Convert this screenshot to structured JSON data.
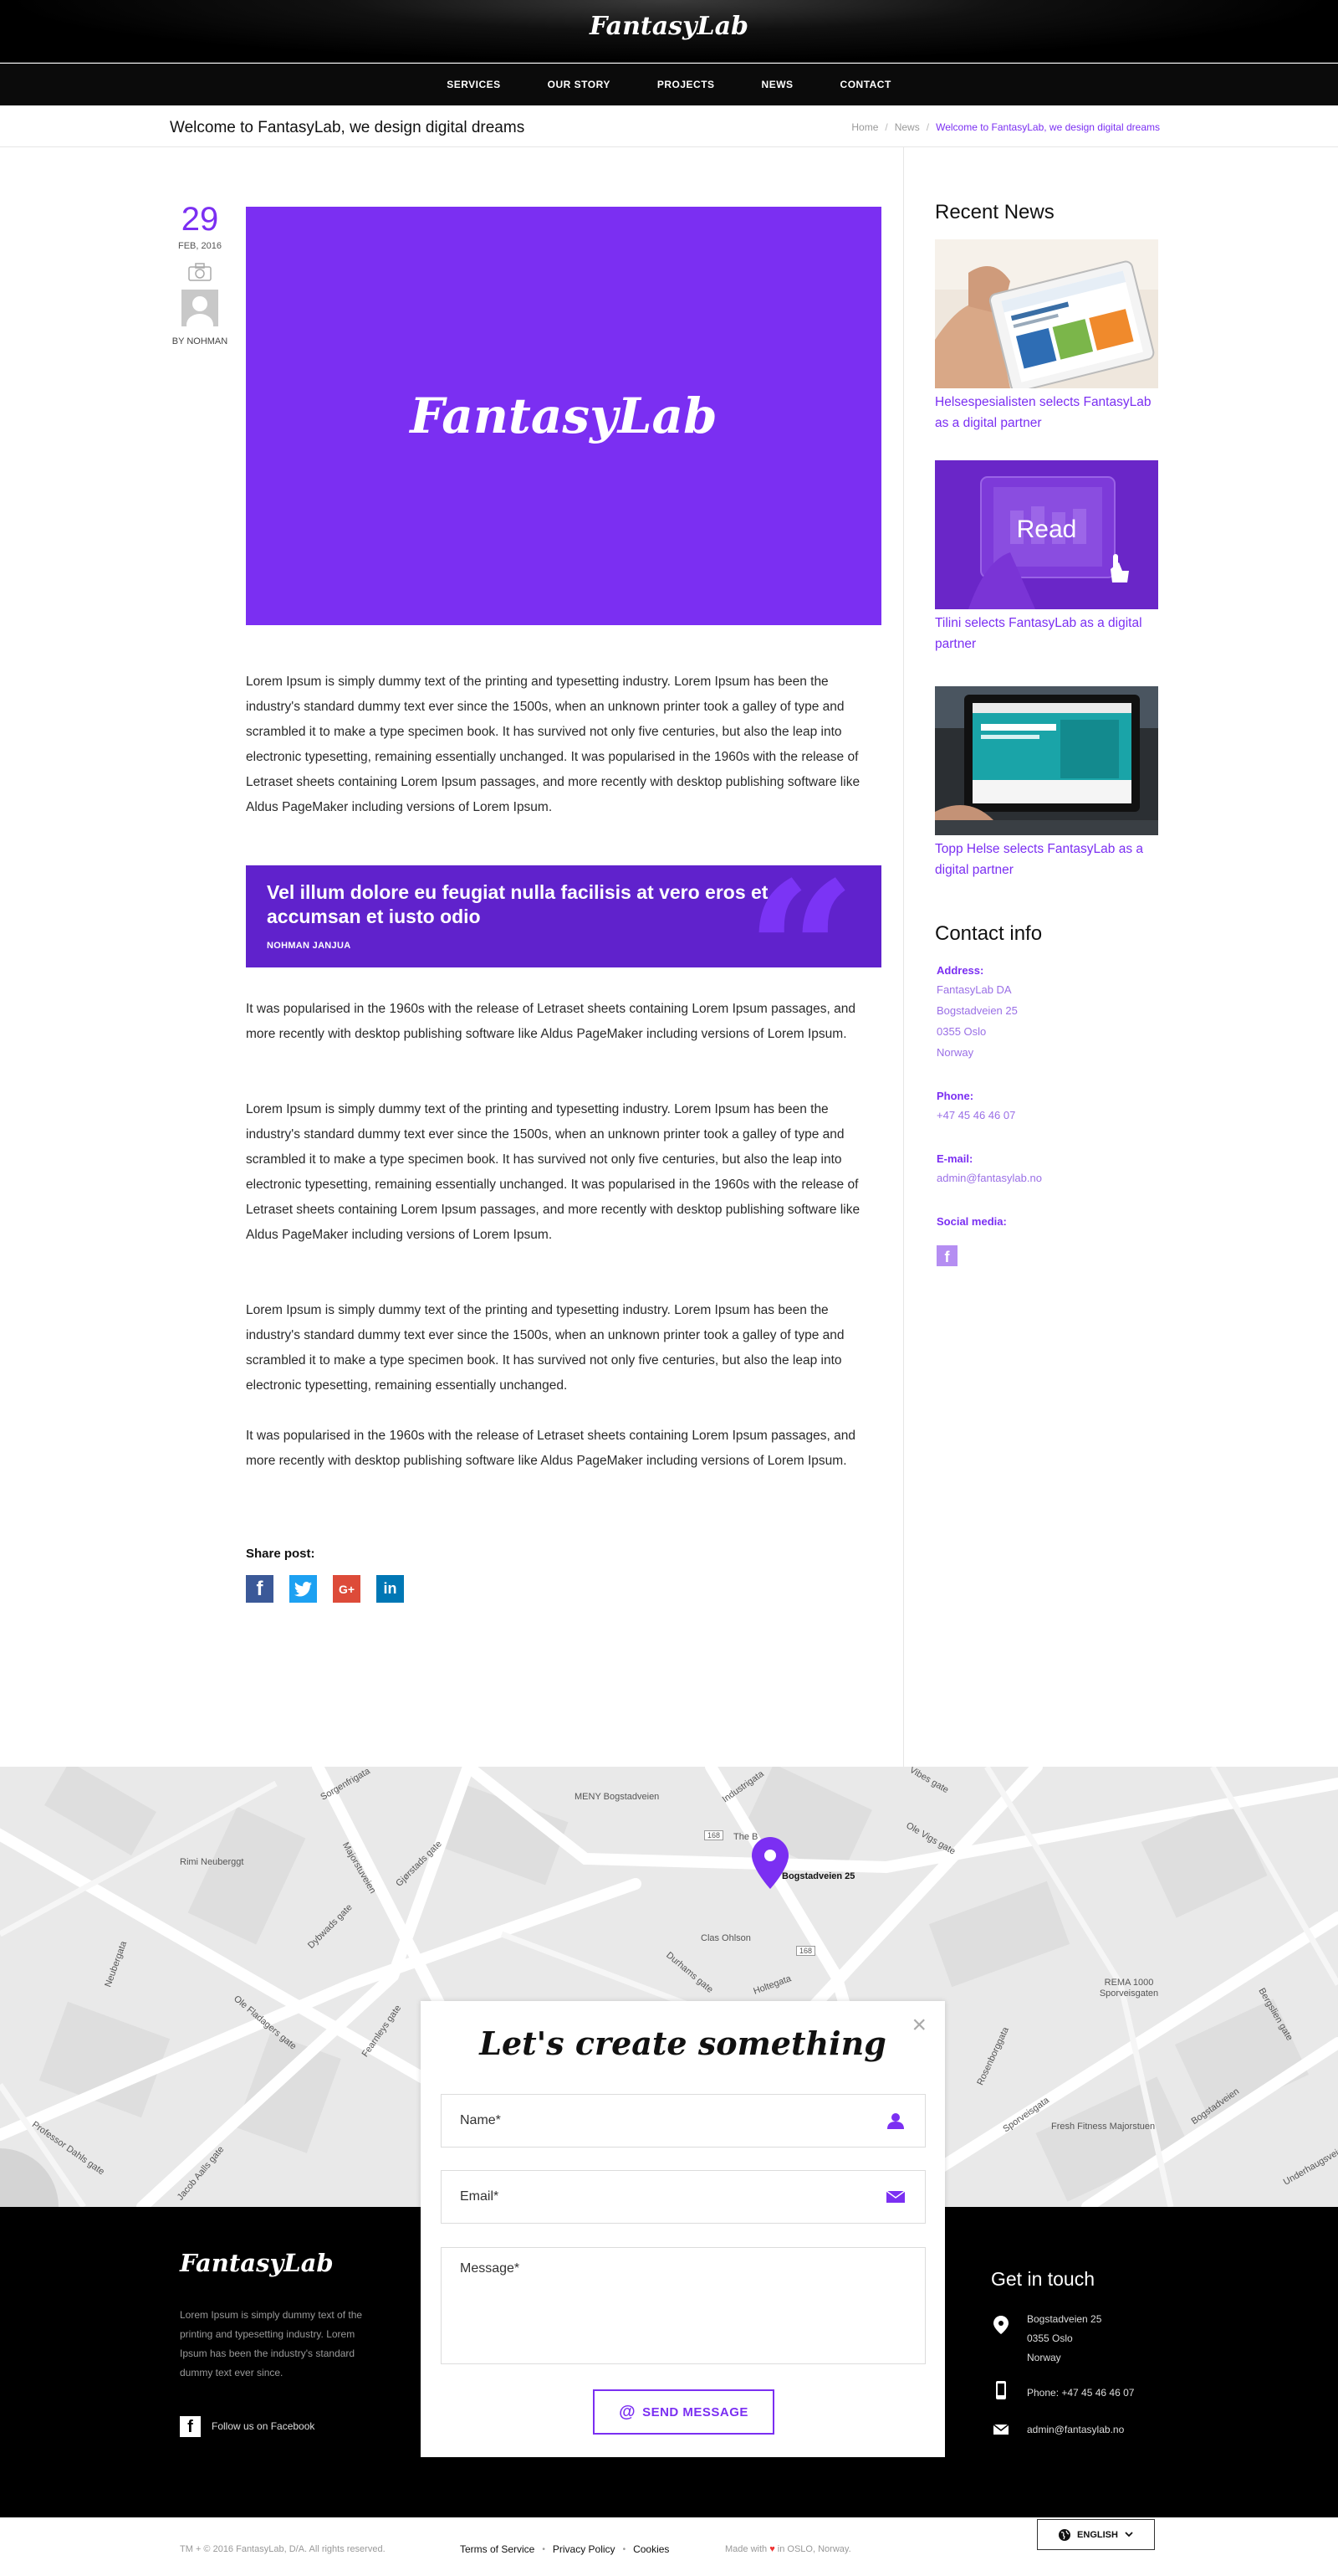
{
  "header": {
    "logo": "FantasyLab",
    "nav": [
      "SERVICES",
      "OUR STORY",
      "PROJECTS",
      "NEWS",
      "CONTACT"
    ]
  },
  "subheader": {
    "title": "Welcome to FantasyLab, we design digital dreams",
    "breadcrumb": [
      "Home",
      "News",
      "Welcome to FantasyLab, we design digital dreams"
    ]
  },
  "post_meta": {
    "day": "29",
    "month": "FEB, 2016",
    "author": "BY NOHMAN"
  },
  "hero": {
    "logo": "FantasyLab"
  },
  "article": {
    "p1": "Lorem Ipsum is simply dummy text of the printing and typesetting industry. Lorem Ipsum has been the industry's standard dummy text ever since the 1500s, when an unknown printer took a galley of type and scrambled it to make a type specimen book. It has survived not only five centuries, but also the leap into electronic typesetting, remaining essentially unchanged. It was popularised in the 1960s with the release of Letraset sheets containing Lorem Ipsum passages, and more recently with desktop publishing software like Aldus PageMaker including versions of Lorem Ipsum.",
    "quote": "Vel illum dolore eu feugiat nulla facilisis at vero eros et accumsan et iusto odio",
    "quote_author": "NOHMAN JANJUA",
    "p2": "It was popularised in the 1960s with the release of Letraset sheets containing Lorem Ipsum passages, and more recently with desktop publishing software like Aldus PageMaker including versions of Lorem Ipsum.",
    "p3": "Lorem Ipsum is simply dummy text of the printing and typesetting industry. Lorem Ipsum has been the industry's standard dummy text ever since the 1500s, when an unknown printer took a galley of type and scrambled it to make a type specimen book. It has survived not only five centuries, but also the leap into electronic typesetting, remaining essentially unchanged. It was popularised in the 1960s with the release of Letraset sheets containing Lorem Ipsum passages, and more recently with desktop publishing software like Aldus PageMaker including versions of Lorem Ipsum.",
    "p4": "Lorem Ipsum is simply dummy text of the printing and typesetting industry. Lorem Ipsum has been the industry's standard dummy text ever since the 1500s, when an unknown printer took a galley of type and scrambled it to make a type specimen book. It has survived not only five centuries, but also the leap into electronic typesetting, remaining essentially unchanged.",
    "p5": "It was popularised in the 1960s with the release of Letraset sheets containing Lorem Ipsum passages, and more recently with desktop publishing software like Aldus PageMaker including versions of Lorem Ipsum.",
    "share_title": "Share post:",
    "share_icons": [
      "facebook-icon",
      "twitter-icon",
      "google-plus-icon",
      "linkedin-icon"
    ]
  },
  "sidebar": {
    "recent_title": "Recent News",
    "news": [
      {
        "title": "Helsespesialisten selects FantasyLab as a digital partner"
      },
      {
        "title": "Tilini selects FantasyLab as a digital partner",
        "overlay": "Read"
      },
      {
        "title": "Topp Helse selects FantasyLab as a digital partner"
      }
    ],
    "contact_title": "Contact info",
    "address_label": "Address:",
    "address_lines": [
      "FantasyLab DA",
      "Bogstadveien 25",
      "0355 Oslo",
      "Norway"
    ],
    "phone_label": "Phone:",
    "phone": "+47 45 46 46 07",
    "email_label": "E-mail:",
    "email": "admin@fantasylab.no",
    "social_label": "Social media:"
  },
  "map": {
    "pin_label": "Bogstadveien 25",
    "labels": [
      "MENY Bogstadveien",
      "Rimi Neuberggt",
      "Clas Ohlson",
      "REMA 1000 Sporveisgaten",
      "Fresh Fitness Majorstuen",
      "The B",
      "Industrigata",
      "Vibes gate",
      "Ole Vigs gate",
      "Sorgenfrigata",
      "Majorstuveien",
      "Gjørstads gate",
      "Dybwads gate",
      "Neubergata",
      "Ole Fladagers gate",
      "Fearnleys gate",
      "Professor Dahls gate",
      "Jacob Aalls gate",
      "Sporveisgata",
      "Bogstadveien",
      "Underhaugsveien",
      "Rosenborggata",
      "Bergslien gate",
      "Durhams gate",
      "Holtegata",
      "168"
    ]
  },
  "popup": {
    "title": "Let's create something",
    "name_placeholder": "Name*",
    "email_placeholder": "Email*",
    "message_placeholder": "Message*",
    "send_label": "SEND MESSAGE"
  },
  "footer": {
    "logo": "FantasyLab",
    "about": "Lorem Ipsum is simply dummy text of the printing and typesetting industry. Lorem Ipsum has been the industry's standard dummy text ever since.",
    "facebook_text": "Follow us on Facebook",
    "get_in_touch": "Get in touch",
    "address_lines": [
      "Bogstadveien 25",
      "0355 Oslo",
      "Norway"
    ],
    "phone": "Phone: +47 45 46 46 07",
    "email": "admin@fantasylab.no"
  },
  "bottom_bar": {
    "copyright": "TM + © 2016 FantasyLab, D/A. All rights reserved.",
    "links": [
      "Terms of Service",
      "Privacy Policy",
      "Cookies"
    ],
    "made_with_prefix": "Made with",
    "made_with_suffix": "in OSLO, Norway.",
    "language": "ENGLISH"
  },
  "colors": {
    "brand_purple": "#7b2ff2",
    "quote_purple": "#6022cc",
    "header_black": "#000000",
    "map_gray": "#e9e9e9"
  }
}
